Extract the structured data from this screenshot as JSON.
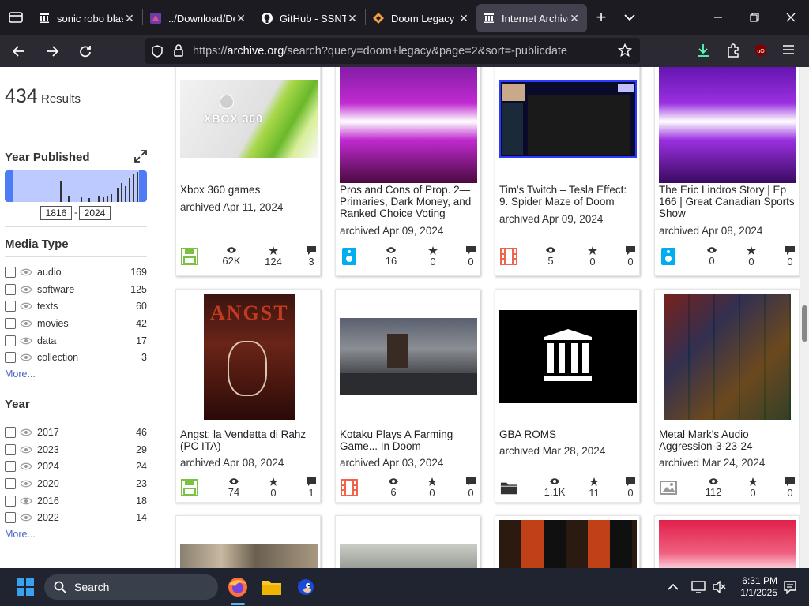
{
  "browser": {
    "tabs": [
      {
        "title": "sonic robo blast",
        "icon": "archive-icon",
        "active": false
      },
      {
        "title": "../Download/De",
        "icon": "page-icon",
        "active": false
      },
      {
        "title": "GitHub - SSNTai",
        "icon": "github-icon",
        "active": false
      },
      {
        "title": "Doom Legacy d",
        "icon": "doom-legacy-icon",
        "active": false
      },
      {
        "title": "Internet Archive",
        "icon": "archive-icon",
        "active": true
      }
    ],
    "url_prefix": "https://",
    "url_domain": "archive.org",
    "url_rest": "/search?query=doom+legacy&page=2&sort=-publicdate"
  },
  "sidebar": {
    "results_count": "434",
    "results_label": "Results",
    "year_published_title": "Year Published",
    "year_from": "1816",
    "year_to": "2024",
    "year_sep": "-",
    "media_type_title": "Media Type",
    "media_types": [
      {
        "label": "audio",
        "count": "169"
      },
      {
        "label": "software",
        "count": "125"
      },
      {
        "label": "texts",
        "count": "60"
      },
      {
        "label": "movies",
        "count": "42"
      },
      {
        "label": "data",
        "count": "17"
      },
      {
        "label": "collection",
        "count": "3"
      }
    ],
    "more_label": "More...",
    "year_title": "Year",
    "years": [
      {
        "label": "2017",
        "count": "46"
      },
      {
        "label": "2023",
        "count": "29"
      },
      {
        "label": "2024",
        "count": "24"
      },
      {
        "label": "2020",
        "count": "23"
      },
      {
        "label": "2016",
        "count": "18"
      },
      {
        "label": "2022",
        "count": "14"
      }
    ]
  },
  "tiles": [
    {
      "title": "Xbox 360 games",
      "date": "archived Apr 11, 2024",
      "mediatype": "software",
      "views": "62K",
      "favs": "124",
      "reviews": "3"
    },
    {
      "title": "Pros and Cons of Prop. 2—Primaries, Dark Money, and Ranked Choice Voting",
      "date": "archived Apr 09, 2024",
      "mediatype": "audio",
      "views": "16",
      "favs": "0",
      "reviews": "0"
    },
    {
      "title": "Tim's Twitch – Tesla Effect: 9. Spider Maze of Doom",
      "date": "archived Apr 09, 2024",
      "mediatype": "movies",
      "views": "5",
      "favs": "0",
      "reviews": "0"
    },
    {
      "title": "The Eric Lindros Story | Ep 166 | Great Canadian Sports Show",
      "date": "archived Apr 08, 2024",
      "mediatype": "audio",
      "views": "0",
      "favs": "0",
      "reviews": "0"
    },
    {
      "title": "Angst: la Vendetta di Rahz (PC ITA)",
      "date": "archived Apr 08, 2024",
      "mediatype": "software",
      "views": "74",
      "favs": "0",
      "reviews": "1"
    },
    {
      "title": "Kotaku Plays A Farming Game... In Doom",
      "date": "archived Apr 03, 2024",
      "mediatype": "movies",
      "views": "6",
      "favs": "0",
      "reviews": "0"
    },
    {
      "title": "GBA ROMS",
      "date": "archived Mar 28, 2024",
      "mediatype": "collection",
      "views": "1.1K",
      "favs": "11",
      "reviews": "0"
    },
    {
      "title": "Metal Mark's Audio Aggression-3-23-24",
      "date": "archived Mar 24, 2024",
      "mediatype": "image",
      "views": "112",
      "favs": "0",
      "reviews": "0"
    }
  ],
  "thumbs": {
    "xbox_label": "XBOX 360",
    "angst_label": "ANGST"
  },
  "taskbar": {
    "search_label": "Search",
    "time": "6:31 PM",
    "date": "1/1/2025"
  }
}
